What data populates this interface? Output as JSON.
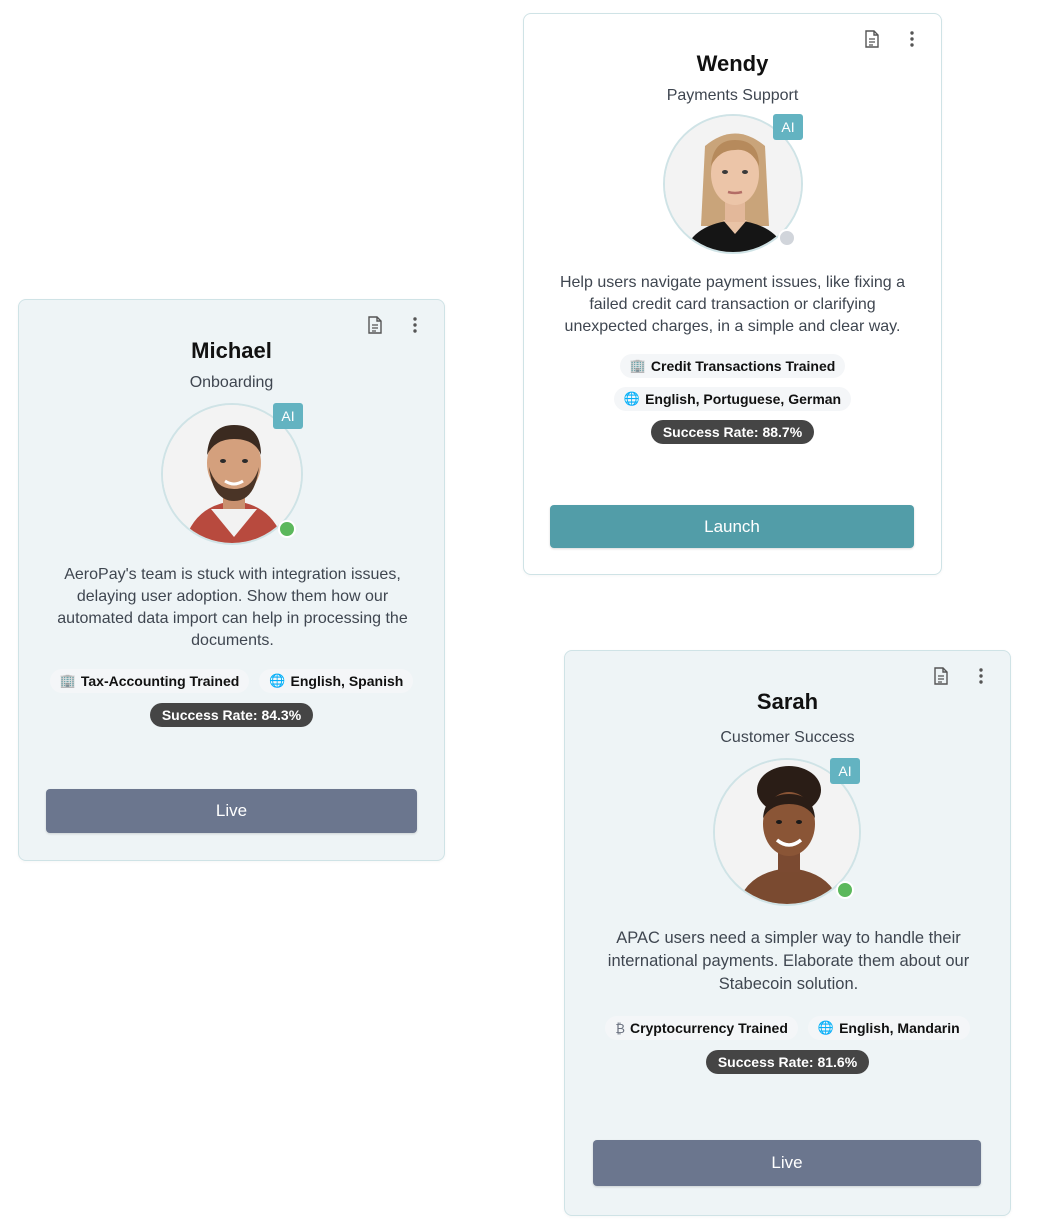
{
  "agents": [
    {
      "name": "Michael",
      "role": "Onboarding",
      "ai_badge": "AI",
      "status": "online",
      "description": "AeroPay's team is stuck with integration issues, delaying user adoption. Show them how our automated data import can help in processing the documents.",
      "chips": [
        {
          "icon": "building-icon",
          "glyph": "🏢",
          "label": "Tax-Accounting Trained"
        },
        {
          "icon": "globe-icon",
          "glyph": "🌐",
          "label": "English, Spanish"
        }
      ],
      "success_rate": "Success Rate: 84.3%",
      "button_label": "Live",
      "button_color": "#6b768e"
    },
    {
      "name": "Wendy",
      "role": "Payments Support",
      "ai_badge": "AI",
      "status": "offline",
      "description": "Help users navigate payment issues, like fixing a failed credit card transaction or clarifying unexpected charges, in a simple and clear way.",
      "chips": [
        {
          "icon": "building-icon",
          "glyph": "🏢",
          "label": "Credit Transactions Trained"
        },
        {
          "icon": "globe-icon",
          "glyph": "🌐",
          "label": "English, Portuguese, German"
        }
      ],
      "success_rate": "Success Rate: 88.7%",
      "button_label": "Launch",
      "button_color": "#529da8"
    },
    {
      "name": "Sarah",
      "role": "Customer Success",
      "ai_badge": "AI",
      "status": "online",
      "description": "APAC users need a simpler way to handle their international payments. Elaborate them about our Stabecoin solution.",
      "chips": [
        {
          "icon": "bitcoin-icon",
          "glyph": "₿",
          "label": "Cryptocurrency Trained"
        },
        {
          "icon": "globe-icon",
          "glyph": "🌐",
          "label": "English, Mandarin"
        }
      ],
      "success_rate": "Success Rate: 81.6%",
      "button_label": "Live",
      "button_color": "#6b768e"
    }
  ],
  "colors": {
    "online": "#5cb85c",
    "offline": "#d1d5db",
    "ai_badge": "#63b3c1"
  }
}
